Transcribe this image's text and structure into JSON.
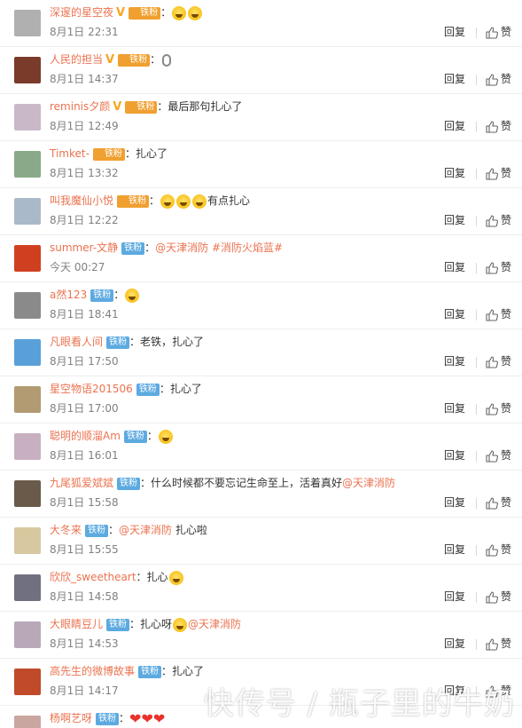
{
  "labels": {
    "fan": "铁粉",
    "reply": "回复",
    "like": "赞",
    "colon": "："
  },
  "comments": [
    {
      "user": "深邃的星空夜",
      "verified": true,
      "fan_style": "gold",
      "text": "",
      "emojis": 2,
      "time": "8月1日 22:31",
      "avatar_color": "#b0b0b0"
    },
    {
      "user": "人民的担当",
      "verified": true,
      "fan_style": "gold",
      "text": "",
      "emojis": 0,
      "icon": "mic",
      "time": "8月1日 14:37",
      "avatar_color": "#7a3b2a"
    },
    {
      "user": "reminis夕颜",
      "verified": true,
      "fan_style": "gold",
      "text": "最后那句扎心了",
      "emojis": 0,
      "time": "8月1日 12:49",
      "avatar_color": "#c9b8c8"
    },
    {
      "user": "Timket-",
      "verified": false,
      "fan_style": "gold",
      "text": "扎心了",
      "emojis": 0,
      "time": "8月1日 13:32",
      "avatar_color": "#88aa88"
    },
    {
      "user": "叫我魔仙小悦",
      "verified": false,
      "fan_style": "gold",
      "text": "有点扎心",
      "emojis": 3,
      "emoji_first": true,
      "time": "8月1日 12:22",
      "avatar_color": "#a9b9c9"
    },
    {
      "user": "summer-文静",
      "verified": false,
      "fan_style": "blue",
      "text": "",
      "mentions": [
        "@天津消防",
        "#消防火焰蓝#"
      ],
      "time": "今天 00:27",
      "avatar_color": "#d04020"
    },
    {
      "user": "a然123",
      "verified": false,
      "fan_style": "blue",
      "text": "",
      "emojis": 1,
      "time": "8月1日 18:41",
      "avatar_color": "#8a8a8a"
    },
    {
      "user": "凡眼看人间",
      "verified": false,
      "fan_style": "blue",
      "text": "老铁，扎心了",
      "emojis": 0,
      "time": "8月1日 17:50",
      "avatar_color": "#5aa0d8"
    },
    {
      "user": "星空物语201506",
      "verified": false,
      "fan_style": "blue",
      "text": "扎心了",
      "emojis": 0,
      "time": "8月1日 17:00",
      "avatar_color": "#b29a72"
    },
    {
      "user": "聪明的顺溜Am",
      "verified": false,
      "fan_style": "blue",
      "text": "",
      "emojis": 1,
      "time": "8月1日 16:01",
      "avatar_color": "#c8b0c0"
    },
    {
      "user": "九尾狐爱斌斌",
      "verified": false,
      "fan_style": "blue",
      "text": "什么时候都不要忘记生命至上，活着真好",
      "mentions_after": [
        "@天津消防"
      ],
      "time": "8月1日 15:58",
      "avatar_color": "#6a5a4a"
    },
    {
      "user": "大冬来",
      "verified": false,
      "fan_style": "blue",
      "text": "",
      "mentions": [
        "@天津消防"
      ],
      "text_after": " 扎心啦",
      "time": "8月1日 15:55",
      "avatar_color": "#d8c8a0"
    },
    {
      "user": "欣欣_sweetheart",
      "verified": false,
      "fan_style": "none",
      "text": "扎心",
      "emojis": 1,
      "time": "8月1日 14:58",
      "avatar_color": "#707080"
    },
    {
      "user": "大眼睛豆儿",
      "verified": false,
      "fan_style": "blue",
      "text": "扎心呀",
      "emojis": 1,
      "mentions_after": [
        "@天津消防"
      ],
      "time": "8月1日 14:53",
      "avatar_color": "#b8a8b8"
    },
    {
      "user": "高先生的微博故事",
      "verified": false,
      "fan_style": "blue",
      "text": "扎心了",
      "emojis": 0,
      "time": "8月1日 14:17",
      "avatar_color": "#c04a2a"
    },
    {
      "user": "杨啊艺呀",
      "verified": false,
      "fan_style": "blue",
      "text": "",
      "hearts": 3,
      "time": "",
      "avatar_color": "#caa6a0"
    }
  ],
  "watermark": "快传号 / 瓶子里的牛奶"
}
